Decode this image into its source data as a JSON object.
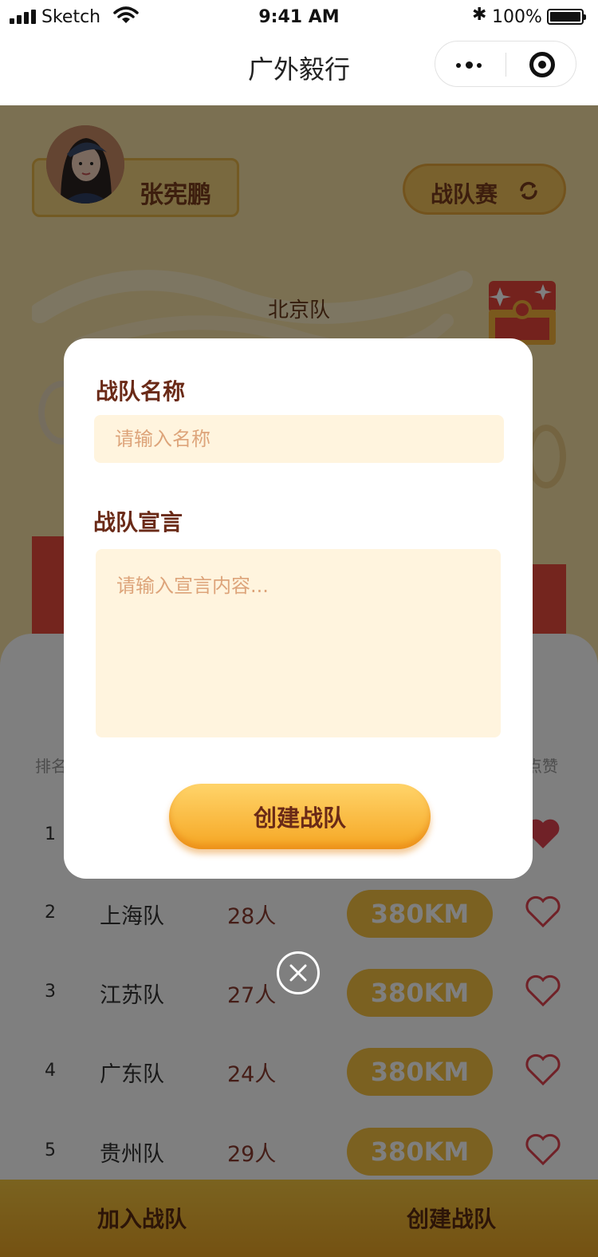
{
  "status_bar": {
    "carrier": "Sketch",
    "time": "9:41 AM",
    "battery": "100%"
  },
  "nav": {
    "title": "广外毅行"
  },
  "header": {
    "user_name": "张宪鹏",
    "mode_label": "战队赛",
    "team_title": "北京队"
  },
  "board": {
    "col_rank": "排名",
    "col_like": "点赞",
    "rows": [
      {
        "rank": "1",
        "name": "",
        "count": "",
        "distance": "",
        "liked": true
      },
      {
        "rank": "2",
        "name": "上海队",
        "count": "28人",
        "distance": "380KM",
        "liked": false
      },
      {
        "rank": "3",
        "name": "江苏队",
        "count": "27人",
        "distance": "380KM",
        "liked": false
      },
      {
        "rank": "4",
        "name": "广东队",
        "count": "24人",
        "distance": "380KM",
        "liked": false
      },
      {
        "rank": "5",
        "name": "贵州队",
        "count": "29人",
        "distance": "380KM",
        "liked": false
      }
    ]
  },
  "bottom_bar": {
    "join_label": "加入战队",
    "create_label": "创建战队"
  },
  "modal": {
    "name_label": "战队名称",
    "name_placeholder": "请输入名称",
    "motto_label": "战队宣言",
    "motto_placeholder": "请输入宣言内容...",
    "submit_label": "创建战队"
  },
  "colors": {
    "accent": "#f5a623",
    "brand_brown": "#6a2a17",
    "input_bg": "#fff4de",
    "heart": "#e0434f"
  }
}
